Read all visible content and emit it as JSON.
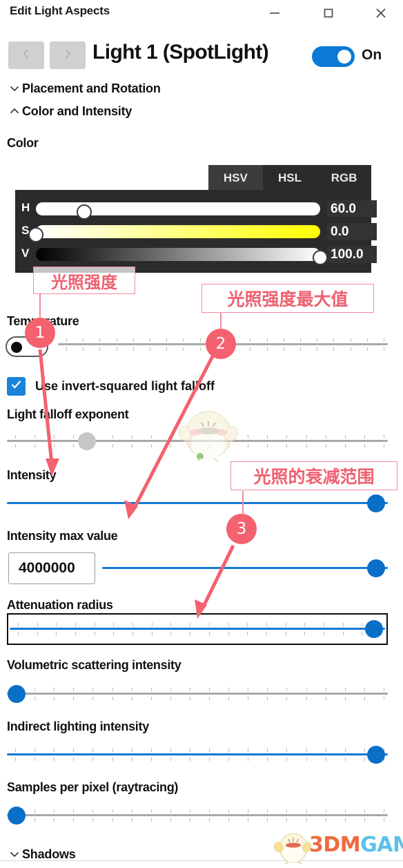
{
  "window": {
    "title": "Edit Light Aspects",
    "minimize_icon": "minimize-icon",
    "maximize_icon": "maximize-icon",
    "close_icon": "close-icon"
  },
  "header": {
    "prev_icon": "chevron-left-icon",
    "next_icon": "chevron-right-icon",
    "light_title": "Light 1 (SpotLight)",
    "toggle_state_label": "On"
  },
  "sections": [
    {
      "label": "Placement and Rotation",
      "chevron": "chevron-down-icon",
      "expanded": false
    },
    {
      "label": "Color and Intensity",
      "chevron": "chevron-up-icon",
      "expanded": true
    },
    {
      "label": "Shadows",
      "chevron": "chevron-down-icon",
      "expanded": false
    }
  ],
  "color": {
    "label": "Color",
    "tabs": [
      {
        "label": "HSV",
        "active": true
      },
      {
        "label": "HSL",
        "active": false
      },
      {
        "label": "RGB",
        "active": false
      }
    ],
    "channels": [
      {
        "key": "H",
        "value": "60.0",
        "percent": 17
      },
      {
        "key": "S",
        "value": "0.0",
        "percent": 0
      },
      {
        "key": "V",
        "value": "100.0",
        "percent": 100
      }
    ]
  },
  "fields": {
    "temperature": {
      "label": "Temperature",
      "toggle": "off",
      "slider_percent": 48,
      "enabled": false
    },
    "invert_squared": {
      "label": "Use invert-squared light falloff",
      "checked": true,
      "check_icon": "checkmark-icon"
    },
    "falloff_exponent": {
      "label": "Light falloff exponent",
      "slider_percent": 21,
      "enabled": false
    },
    "intensity": {
      "label": "Intensity",
      "slider_percent": 100,
      "enabled": true
    },
    "intensity_max_value": {
      "label": "Intensity max value",
      "input_value": "4000000",
      "slider_percent": 100,
      "enabled": true
    },
    "attenuation_radius": {
      "label": "Attenuation radius",
      "slider_percent": 100,
      "enabled": true,
      "focused": true
    },
    "volumetric_scattering": {
      "label": "Volumetric scattering intensity",
      "slider_percent": 0,
      "enabled": false
    },
    "indirect_lighting": {
      "label": "Indirect lighting intensity",
      "slider_percent": 100,
      "enabled": true
    },
    "samples_per_pixel": {
      "label": "Samples per pixel (raytracing)",
      "slider_percent": 0,
      "enabled": false
    }
  },
  "annotations": [
    {
      "number": "1",
      "text": "光照强度"
    },
    {
      "number": "2",
      "text": "光照强度最大值"
    },
    {
      "number": "3",
      "text": "光照的衰减范围"
    }
  ],
  "watermark": {
    "brand_part1": "3DM",
    "brand_part2": "GAME",
    "mascot": "chick-mascot-icon"
  },
  "colors": {
    "accent_blue": "#0a6fc7",
    "track_blue": "#1578d4",
    "toggle_blue": "#0a7ad6",
    "annotation_red": "#f4616f",
    "panel_dark": "#2b2b2b",
    "hue_yellow": "#ffff00"
  }
}
